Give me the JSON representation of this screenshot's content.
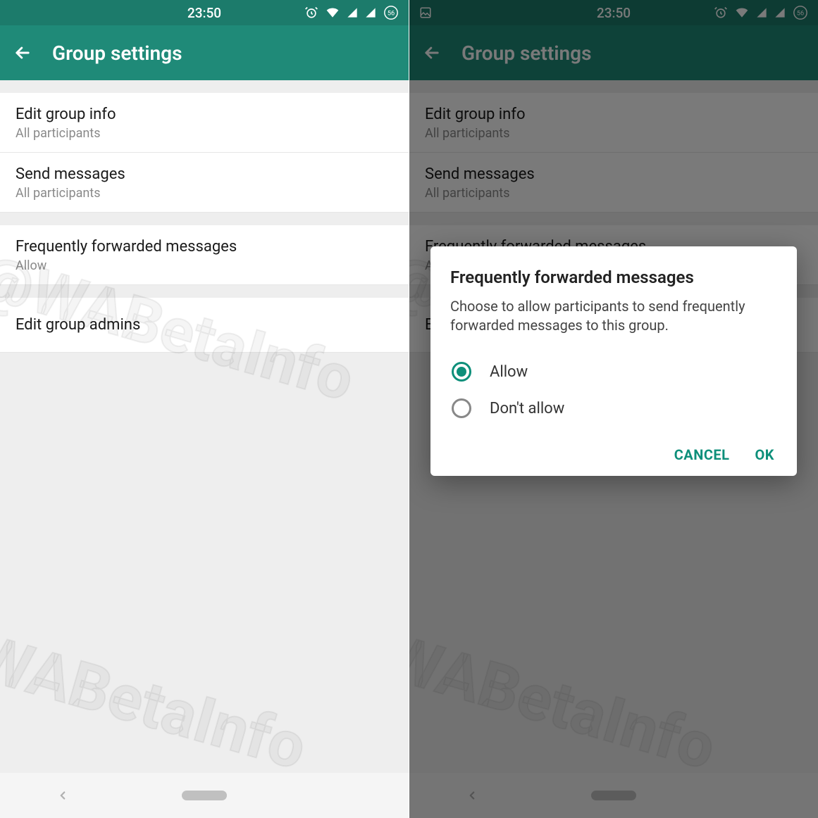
{
  "status": {
    "time": "23:50",
    "battery": "56"
  },
  "appbar": {
    "title": "Group settings"
  },
  "items": [
    {
      "title": "Edit group info",
      "sub": "All participants"
    },
    {
      "title": "Send messages",
      "sub": "All participants"
    },
    {
      "title": "Frequently forwarded messages",
      "sub": "Allow"
    },
    {
      "title": "Edit group admins",
      "sub": ""
    }
  ],
  "dialog": {
    "title": "Frequently forwarded messages",
    "desc": "Choose to allow participants to send frequently forwarded messages to this group.",
    "options": [
      {
        "label": "Allow",
        "checked": true
      },
      {
        "label": "Don't allow",
        "checked": false
      }
    ],
    "cancel": "CANCEL",
    "ok": "OK"
  },
  "watermark": "@WABetaInfo"
}
